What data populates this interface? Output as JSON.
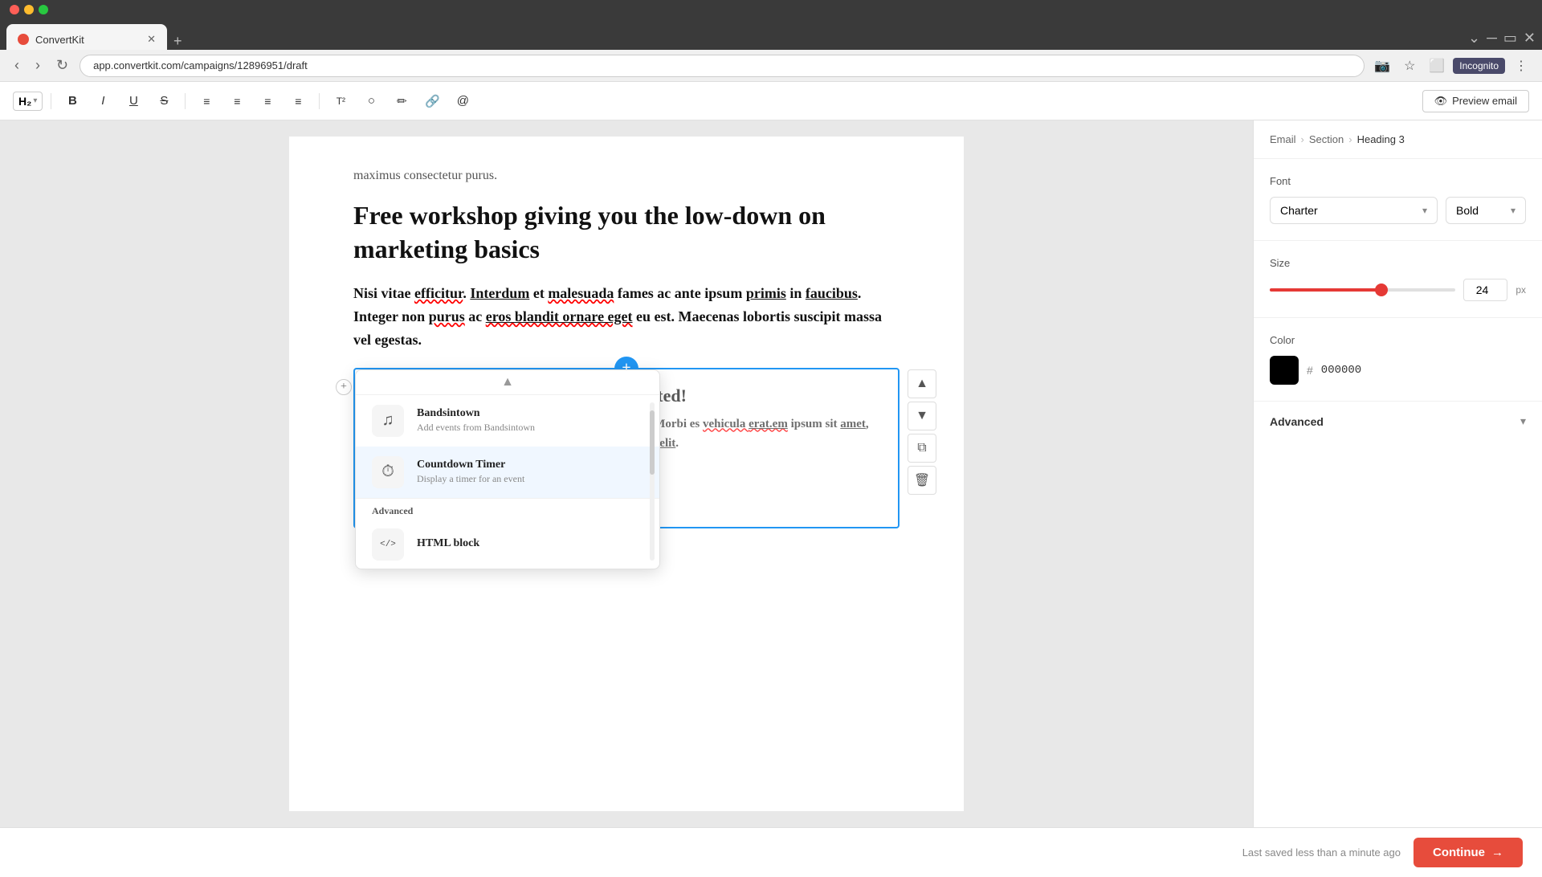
{
  "browser": {
    "tab_title": "ConvertKit",
    "tab_favicon": "CK",
    "address": "app.convertkit.com/campaigns/12896951/draft",
    "incognito_label": "Incognito"
  },
  "toolbar": {
    "heading_label": "H₂",
    "bold_label": "B",
    "italic_label": "I",
    "underline_label": "U",
    "strikethrough_label": "S",
    "preview_label": "Preview email"
  },
  "editor": {
    "intro_text": "maximus consectetur purus.",
    "heading_text": "Free workshop giving you the low-down on marketing basics",
    "body_text": "Nisi vitae efficitur. Interdum et malesuada fames ac ante ipsum primis in faucibus. Integer non purus ac eros blandit ornare eget eu est. Maecenas lobortis suscipit massa vel egestas.",
    "block_inner_heading": "ces are limited!",
    "block_inner_text": "c sed orci vitae. Morbi es vehicula erat.em ipsum sit amet, consectetur adip elit."
  },
  "dropdown": {
    "item1_title": "Bandsintown",
    "item1_desc": "Add events from Bandsintown",
    "item2_title": "Countdown Timer",
    "item2_desc": "Display a timer for an event",
    "section_label": "Advanced",
    "item3_title": "HTML block"
  },
  "right_panel": {
    "breadcrumb_email": "Email",
    "breadcrumb_section": "Section",
    "breadcrumb_heading": "Heading 3",
    "font_label": "Font",
    "font_name": "Charter",
    "font_weight": "Bold",
    "size_label": "Size",
    "size_value": "24",
    "size_unit": "px",
    "color_label": "Color",
    "color_hex": "000000",
    "advanced_label": "Advanced"
  },
  "footer": {
    "saved_text": "Last saved less than a minute ago",
    "continue_label": "Continue"
  }
}
